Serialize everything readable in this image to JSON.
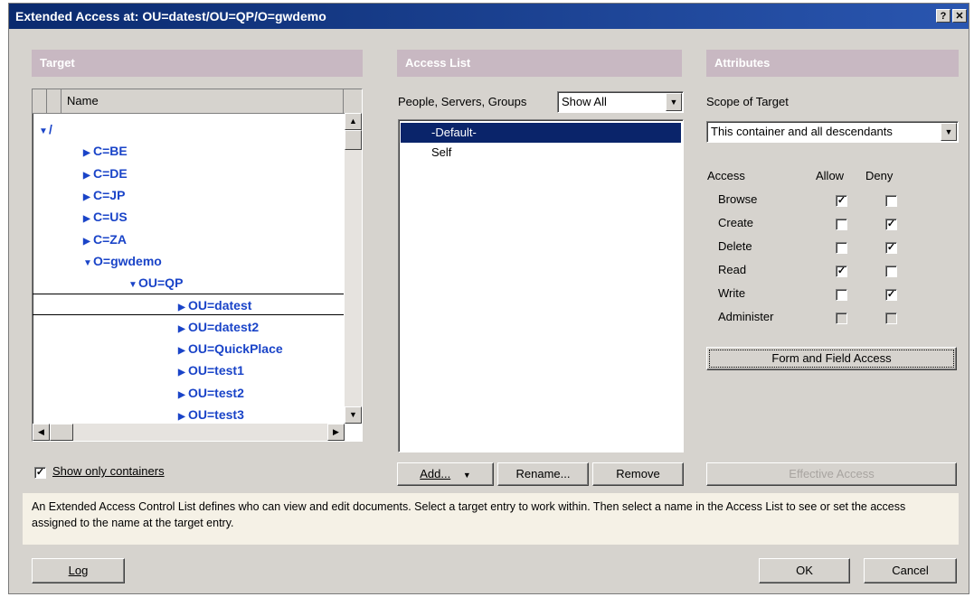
{
  "window": {
    "title": "Extended Access at: OU=datest/OU=QP/O=gwdemo",
    "help_glyph": "?",
    "close_glyph": "✕"
  },
  "target": {
    "header": "Target",
    "column_name": "Name",
    "tree": [
      {
        "label": "/",
        "level": 0,
        "expanded": true
      },
      {
        "label": "C=BE",
        "level": 1,
        "expanded": false
      },
      {
        "label": "C=DE",
        "level": 1,
        "expanded": false
      },
      {
        "label": "C=JP",
        "level": 1,
        "expanded": false
      },
      {
        "label": "C=US",
        "level": 1,
        "expanded": false
      },
      {
        "label": "C=ZA",
        "level": 1,
        "expanded": false
      },
      {
        "label": "O=gwdemo",
        "level": 1,
        "expanded": true
      },
      {
        "label": "OU=QP",
        "level": 2,
        "expanded": true
      },
      {
        "label": "OU=datest",
        "level": 3,
        "expanded": false,
        "selected": true
      },
      {
        "label": "OU=datest2",
        "level": 3,
        "expanded": false
      },
      {
        "label": "OU=QuickPlace",
        "level": 3,
        "expanded": false
      },
      {
        "label": "OU=test1",
        "level": 3,
        "expanded": false
      },
      {
        "label": "OU=test2",
        "level": 3,
        "expanded": false
      },
      {
        "label": "OU=test3",
        "level": 3,
        "expanded": false
      }
    ],
    "show_only_containers_label": "Show only containers",
    "show_only_containers_checked": true
  },
  "access_list": {
    "header": "Access List",
    "filter_label": "People, Servers, Groups",
    "filter_value": "Show All",
    "items": [
      "-Default-",
      "Self"
    ],
    "selected_index": 0,
    "add_label": "Add...",
    "rename_label": "Rename...",
    "remove_label": "Remove"
  },
  "attributes": {
    "header": "Attributes",
    "scope_label": "Scope of Target",
    "scope_value": "This container and all descendants",
    "access_col": "Access",
    "allow_col": "Allow",
    "deny_col": "Deny",
    "rights": [
      {
        "label": "Browse",
        "allow": true,
        "deny": false,
        "enabled": true
      },
      {
        "label": "Create",
        "allow": false,
        "deny": true,
        "enabled": true
      },
      {
        "label": "Delete",
        "allow": false,
        "deny": true,
        "enabled": true
      },
      {
        "label": "Read",
        "allow": true,
        "deny": false,
        "enabled": true
      },
      {
        "label": "Write",
        "allow": false,
        "deny": true,
        "enabled": true
      },
      {
        "label": "Administer",
        "allow": false,
        "deny": false,
        "enabled": false
      }
    ],
    "form_field_button": "Form and Field Access",
    "effective_access_button": "Effective Access"
  },
  "info_text": "An Extended Access Control List defines who can view and edit documents.  Select a target entry to work within.  Then select a name in the Access List to see or set the access assigned to the name at the target entry.",
  "footer": {
    "log_label": "Log",
    "ok_label": "OK",
    "cancel_label": "Cancel"
  }
}
